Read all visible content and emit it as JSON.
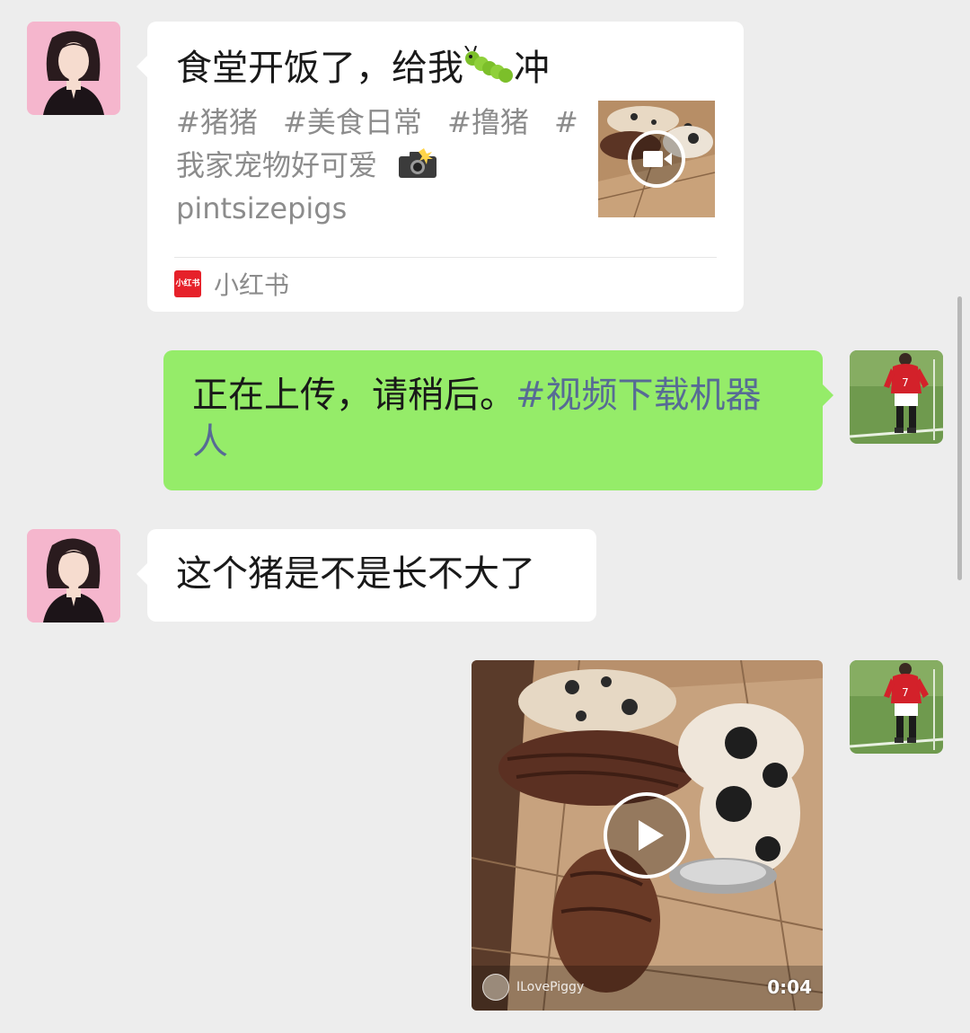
{
  "messages": {
    "card": {
      "title_text": "食堂开饭了，给我",
      "title_emoji": "caterpillar-emoji",
      "title_suffix": "冲",
      "tags_line1": [
        "#猪猪",
        "#美食日常",
        "#撸猪",
        "#"
      ],
      "tags_line2": "我家宠物好可爱",
      "tags_line2_emoji": "camera-flash-emoji",
      "tags_line3": "pintsizepigs",
      "thumbnail_icon": "video-camera-icon",
      "source_logo_text": "小红书",
      "source_name": "小红书"
    },
    "reply_upload": {
      "text_part1": "正在上传，请稍后。",
      "hashtag_part1": "#视频下载机器",
      "hashtag_part2": "人"
    },
    "question": {
      "text": "这个猪是不是长不大了"
    },
    "video": {
      "uploader_name": "ILovePiggy",
      "duration": "0:04",
      "play_icon": "play-icon"
    }
  },
  "colors": {
    "chat_background": "#ededed",
    "bubble_received": "#ffffff",
    "bubble_sent": "#95ec69",
    "link_color": "#576b95",
    "source_logo": "#e6212a"
  }
}
